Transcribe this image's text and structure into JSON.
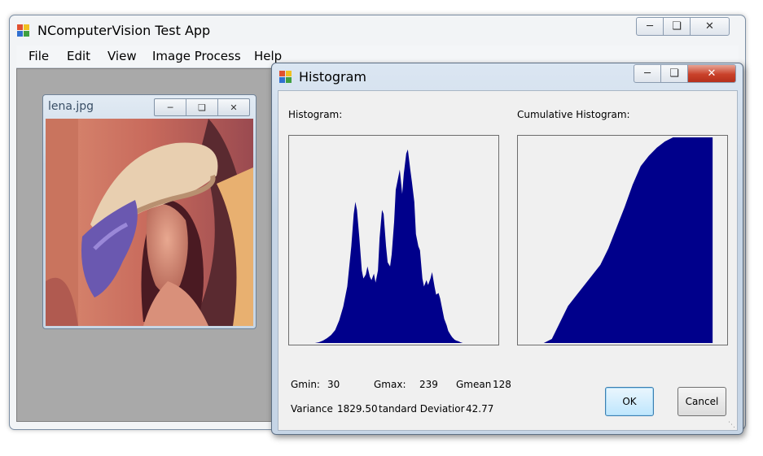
{
  "app": {
    "title": "NComputerVision Test App",
    "menu": [
      "File",
      "Edit",
      "View",
      "Image Process",
      "Help"
    ]
  },
  "child_window": {
    "title": "lena.jpg"
  },
  "dialog": {
    "title": "Histogram",
    "histogram_label": "Histogram:",
    "cumulative_label": "Cumulative Histogram:",
    "stats": {
      "gmin_label": "Gmin:",
      "gmin_value": "30",
      "gmax_label": "Gmax:",
      "gmax_value": "239",
      "gmean_label": "Gmean",
      "gmean_value": "128",
      "variance_label": "Variance",
      "variance_value": "1829.50",
      "stddev_label": "tandard Deviatior",
      "stddev_value": "42.77"
    },
    "ok_label": "OK",
    "cancel_label": "Cancel"
  },
  "colors": {
    "plot_fill": "#00008b",
    "mdi_background": "#a9a9a9"
  },
  "chart_data": [
    {
      "type": "area",
      "title": "Histogram:",
      "xlim": [
        0,
        255
      ],
      "x": [
        30,
        35,
        40,
        45,
        50,
        55,
        60,
        65,
        70,
        75,
        78,
        80,
        82,
        85,
        88,
        90,
        93,
        95,
        98,
        100,
        103,
        105,
        108,
        110,
        113,
        115,
        118,
        120,
        123,
        125,
        128,
        130,
        133,
        135,
        138,
        140,
        143,
        145,
        148,
        150,
        153,
        155,
        158,
        160,
        163,
        165,
        168,
        170,
        173,
        175,
        178,
        180,
        183,
        185,
        188,
        190,
        193,
        195,
        198,
        200,
        203,
        205,
        208,
        210,
        213,
        215,
        218,
        220,
        223,
        225,
        228,
        230,
        233,
        235,
        239
      ],
      "values": [
        0,
        1,
        3,
        6,
        10,
        16,
        28,
        45,
        70,
        120,
        160,
        175,
        165,
        130,
        90,
        80,
        85,
        95,
        82,
        78,
        86,
        75,
        90,
        130,
        165,
        160,
        120,
        100,
        95,
        110,
        150,
        190,
        205,
        215,
        185,
        210,
        235,
        240,
        215,
        200,
        175,
        135,
        120,
        115,
        80,
        70,
        78,
        72,
        80,
        88,
        70,
        60,
        62,
        55,
        40,
        30,
        22,
        15,
        10,
        7,
        4,
        3,
        2,
        1,
        0,
        0,
        0,
        0,
        0,
        0,
        0,
        0,
        0,
        0,
        0
      ],
      "ylim": [
        0,
        255
      ]
    },
    {
      "type": "area",
      "title": "Cumulative Histogram:",
      "xlim": [
        0,
        255
      ],
      "x": [
        30,
        40,
        50,
        60,
        70,
        80,
        90,
        100,
        110,
        120,
        130,
        140,
        150,
        160,
        170,
        180,
        190,
        200,
        210,
        220,
        230,
        239
      ],
      "values": [
        0,
        0.02,
        0.1,
        0.18,
        0.23,
        0.28,
        0.33,
        0.38,
        0.46,
        0.56,
        0.66,
        0.77,
        0.86,
        0.91,
        0.95,
        0.98,
        1,
        1,
        1,
        1,
        1,
        1
      ],
      "ylim": [
        0,
        1
      ]
    }
  ]
}
